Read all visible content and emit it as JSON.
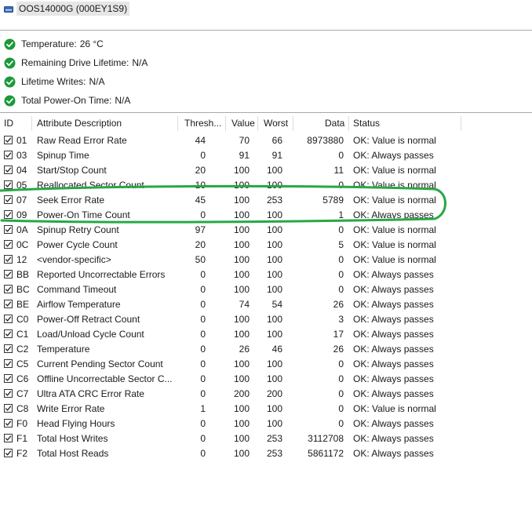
{
  "drive": {
    "title": "OOS14000G (000EY1S9)"
  },
  "summary": [
    {
      "label": "Temperature:",
      "value": "26 °C"
    },
    {
      "label": "Remaining Drive Lifetime:",
      "value": "N/A"
    },
    {
      "label": "Lifetime Writes:",
      "value": "N/A"
    },
    {
      "label": "Total Power-On Time:",
      "value": "N/A"
    }
  ],
  "columns": {
    "id": "ID",
    "desc": "Attribute Description",
    "thresh": "Thresh...",
    "value": "Value",
    "worst": "Worst",
    "data": "Data",
    "status": "Status"
  },
  "rows": [
    {
      "id": "01",
      "desc": "Raw Read Error Rate",
      "thresh": "44",
      "value": "70",
      "worst": "66",
      "data": "8973880",
      "status": "OK: Value is normal"
    },
    {
      "id": "03",
      "desc": "Spinup Time",
      "thresh": "0",
      "value": "91",
      "worst": "91",
      "data": "0",
      "status": "OK: Always passes"
    },
    {
      "id": "04",
      "desc": "Start/Stop Count",
      "thresh": "20",
      "value": "100",
      "worst": "100",
      "data": "11",
      "status": "OK: Value is normal"
    },
    {
      "id": "05",
      "desc": "Reallocated Sector Count",
      "thresh": "10",
      "value": "100",
      "worst": "100",
      "data": "0",
      "status": "OK: Value is normal"
    },
    {
      "id": "07",
      "desc": "Seek Error Rate",
      "thresh": "45",
      "value": "100",
      "worst": "253",
      "data": "5789",
      "status": "OK: Value is normal"
    },
    {
      "id": "09",
      "desc": "Power-On Time Count",
      "thresh": "0",
      "value": "100",
      "worst": "100",
      "data": "1",
      "status": "OK: Always passes"
    },
    {
      "id": "0A",
      "desc": "Spinup Retry Count",
      "thresh": "97",
      "value": "100",
      "worst": "100",
      "data": "0",
      "status": "OK: Value is normal"
    },
    {
      "id": "0C",
      "desc": "Power Cycle Count",
      "thresh": "20",
      "value": "100",
      "worst": "100",
      "data": "5",
      "status": "OK: Value is normal"
    },
    {
      "id": "12",
      "desc": "<vendor-specific>",
      "thresh": "50",
      "value": "100",
      "worst": "100",
      "data": "0",
      "status": "OK: Value is normal"
    },
    {
      "id": "BB",
      "desc": "Reported Uncorrectable Errors",
      "thresh": "0",
      "value": "100",
      "worst": "100",
      "data": "0",
      "status": "OK: Always passes"
    },
    {
      "id": "BC",
      "desc": "Command Timeout",
      "thresh": "0",
      "value": "100",
      "worst": "100",
      "data": "0",
      "status": "OK: Always passes"
    },
    {
      "id": "BE",
      "desc": "Airflow Temperature",
      "thresh": "0",
      "value": "74",
      "worst": "54",
      "data": "26",
      "status": "OK: Always passes"
    },
    {
      "id": "C0",
      "desc": "Power-Off Retract Count",
      "thresh": "0",
      "value": "100",
      "worst": "100",
      "data": "3",
      "status": "OK: Always passes"
    },
    {
      "id": "C1",
      "desc": "Load/Unload Cycle Count",
      "thresh": "0",
      "value": "100",
      "worst": "100",
      "data": "17",
      "status": "OK: Always passes"
    },
    {
      "id": "C2",
      "desc": "Temperature",
      "thresh": "0",
      "value": "26",
      "worst": "46",
      "data": "26",
      "status": "OK: Always passes"
    },
    {
      "id": "C5",
      "desc": "Current Pending Sector Count",
      "thresh": "0",
      "value": "100",
      "worst": "100",
      "data": "0",
      "status": "OK: Always passes"
    },
    {
      "id": "C6",
      "desc": "Offline Uncorrectable Sector C...",
      "thresh": "0",
      "value": "100",
      "worst": "100",
      "data": "0",
      "status": "OK: Always passes"
    },
    {
      "id": "C7",
      "desc": "Ultra ATA CRC Error Rate",
      "thresh": "0",
      "value": "200",
      "worst": "200",
      "data": "0",
      "status": "OK: Always passes"
    },
    {
      "id": "C8",
      "desc": "Write Error Rate",
      "thresh": "1",
      "value": "100",
      "worst": "100",
      "data": "0",
      "status": "OK: Value is normal"
    },
    {
      "id": "F0",
      "desc": "Head Flying Hours",
      "thresh": "0",
      "value": "100",
      "worst": "100",
      "data": "0",
      "status": "OK: Always passes"
    },
    {
      "id": "F1",
      "desc": "Total Host Writes",
      "thresh": "0",
      "value": "100",
      "worst": "253",
      "data": "3112708",
      "status": "OK: Always passes"
    },
    {
      "id": "F2",
      "desc": "Total Host Reads",
      "thresh": "0",
      "value": "100",
      "worst": "253",
      "data": "5861172",
      "status": "OK: Always passes"
    }
  ],
  "colors": {
    "ok_green": "#1a9a3a",
    "highlight_green": "#27a845"
  },
  "icons": {
    "drive": "drive-icon",
    "status": "check-circle-icon",
    "row_check": "checkbox-checked-icon"
  }
}
